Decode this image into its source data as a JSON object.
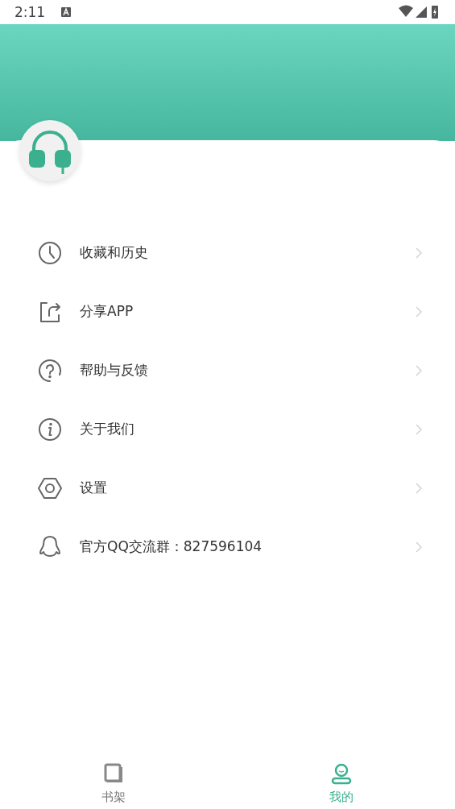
{
  "status_bar": {
    "time": "2:11"
  },
  "menu": [
    {
      "kind": "history",
      "label": "收藏和历史"
    },
    {
      "kind": "share",
      "label": "分享APP"
    },
    {
      "kind": "help",
      "label": "帮助与反馈"
    },
    {
      "kind": "about",
      "label": "关于我们"
    },
    {
      "kind": "settings",
      "label": "设置"
    },
    {
      "kind": "qq",
      "label": "官方QQ交流群：827596104"
    }
  ],
  "tabs": [
    {
      "kind": "bookshelf",
      "label": "书架",
      "selected": false
    },
    {
      "kind": "profile",
      "label": "我的",
      "selected": true
    }
  ]
}
